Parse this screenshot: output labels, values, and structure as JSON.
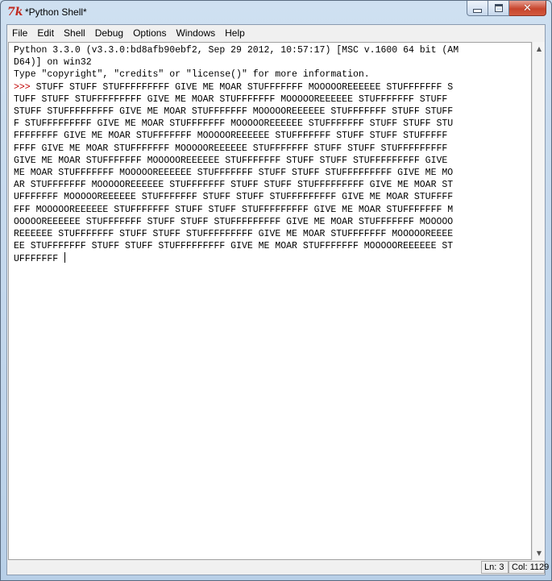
{
  "window": {
    "title": "*Python Shell*",
    "app_icon": "tk-feather-icon",
    "controls": {
      "minimize": "minimize-icon",
      "maximize": "maximize-icon",
      "close": "close-icon",
      "close_glyph": "✕"
    }
  },
  "menu": [
    "File",
    "Edit",
    "Shell",
    "Debug",
    "Options",
    "Windows",
    "Help"
  ],
  "shell": {
    "lines": [
      "Python 3.3.0 (v3.3.0:bd8afb90ebf2, Sep 29 2012, 10:57:17) [MSC v.1600 64 bit (AM",
      "D64)] on win32",
      "Type \"copyright\", \"credits\" or \"license()\" for more information."
    ],
    "prompt": ">>> ",
    "input_lines": [
      "STUFF STUFF STUFFFFFFFFF GIVE ME MOAR STUFFFFFFF MOOOOOREEEEEE STUFFFFFFF S",
      "TUFF STUFF STUFFFFFFFFF GIVE ME MOAR STUFFFFFFF MOOOOOREEEEEE STUFFFFFFF STUFF",
      "STUFF STUFFFFFFFFF GIVE ME MOAR STUFFFFFFF MOOOOOREEEEEE STUFFFFFFF STUFF STUFF",
      "F STUFFFFFFFFF GIVE ME MOAR STUFFFFFFF MOOOOOREEEEEE STUFFFFFFF STUFF STUFF STU",
      "FFFFFFFF GIVE ME MOAR STUFFFFFFF MOOOOOREEEEEE STUFFFFFFF STUFF STUFF STUFFFFF",
      "FFFF GIVE ME MOAR STUFFFFFFF MOOOOOREEEEEE STUFFFFFFF STUFF STUFF STUFFFFFFFFF",
      "GIVE ME MOAR STUFFFFFFF MOOOOOREEEEEE STUFFFFFFF STUFF STUFF STUFFFFFFFFF GIVE",
      "ME MOAR STUFFFFFFF MOOOOOREEEEEE STUFFFFFFF STUFF STUFF STUFFFFFFFFF GIVE ME MO",
      "AR STUFFFFFFF MOOOOOREEEEEE STUFFFFFFF STUFF STUFF STUFFFFFFFFF GIVE ME MOAR ST",
      "UFFFFFFF MOOOOOREEEEEE STUFFFFFFF STUFF STUFF STUFFFFFFFFF GIVE ME MOAR STUFFFF",
      "FFF MOOOOOREEEEEE STUFFFFFFF STUFF STUFF STUFFFFFFFFF GIVE ME MOAR STUFFFFFFF M",
      "OOOOOREEEEEE STUFFFFFFF STUFF STUFF STUFFFFFFFFF GIVE ME MOAR STUFFFFFFF MOOOOO",
      "REEEEEE STUFFFFFFF STUFF STUFF STUFFFFFFFFF GIVE ME MOAR STUFFFFFFF MOOOOOREEEE",
      "EE STUFFFFFFF STUFF STUFF STUFFFFFFFFF GIVE ME MOAR STUFFFFFFF MOOOOOREEEEEE ST",
      "UFFFFFFF "
    ]
  },
  "status": {
    "line": "Ln: 3",
    "col": "Col: 1129"
  },
  "colors": {
    "prompt": "#c00000",
    "close_button": "#c7452d"
  }
}
